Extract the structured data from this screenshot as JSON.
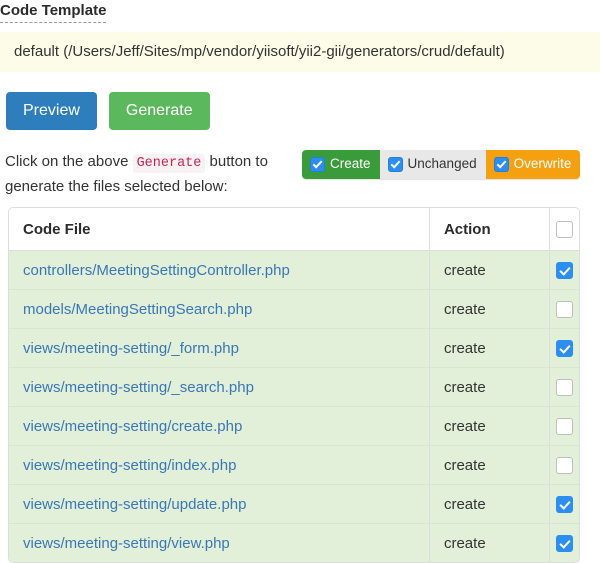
{
  "form": {
    "label": "Code Template",
    "template_value": "default (/Users/Jeff/Sites/mp/vendor/yiisoft/yii2-gii/generators/crud/default)"
  },
  "buttons": {
    "preview": "Preview",
    "generate": "Generate"
  },
  "hint": {
    "before": "Click on the above ",
    "code": "Generate",
    "after": " button to generate the files selected below:"
  },
  "filters": [
    {
      "label": "Create",
      "checked": true,
      "color": "#3a9b3a"
    },
    {
      "label": "Unchanged",
      "checked": true,
      "color": "#e8e8e8"
    },
    {
      "label": "Overwrite",
      "checked": true,
      "color": "#f5a011"
    }
  ],
  "table": {
    "headers": {
      "file": "Code File",
      "action": "Action",
      "check": ""
    },
    "header_checked": false,
    "rows": [
      {
        "file": "controllers/MeetingSettingController.php",
        "action": "create",
        "checked": true
      },
      {
        "file": "models/MeetingSettingSearch.php",
        "action": "create",
        "checked": false
      },
      {
        "file": "views/meeting-setting/_form.php",
        "action": "create",
        "checked": true
      },
      {
        "file": "views/meeting-setting/_search.php",
        "action": "create",
        "checked": false
      },
      {
        "file": "views/meeting-setting/create.php",
        "action": "create",
        "checked": false
      },
      {
        "file": "views/meeting-setting/index.php",
        "action": "create",
        "checked": false
      },
      {
        "file": "views/meeting-setting/update.php",
        "action": "create",
        "checked": true
      },
      {
        "file": "views/meeting-setting/view.php",
        "action": "create",
        "checked": true
      }
    ]
  },
  "colors": {
    "preview_button": "#2e7ebd",
    "generate_button": "#5cb85c",
    "row_create": "#e2efd9",
    "checkbox_on": "#2b8ef0",
    "inline_code_text": "#c7254e",
    "inline_code_bg": "#f9f2f4",
    "select_bg": "#fcfce8",
    "link": "#3a77b5"
  }
}
